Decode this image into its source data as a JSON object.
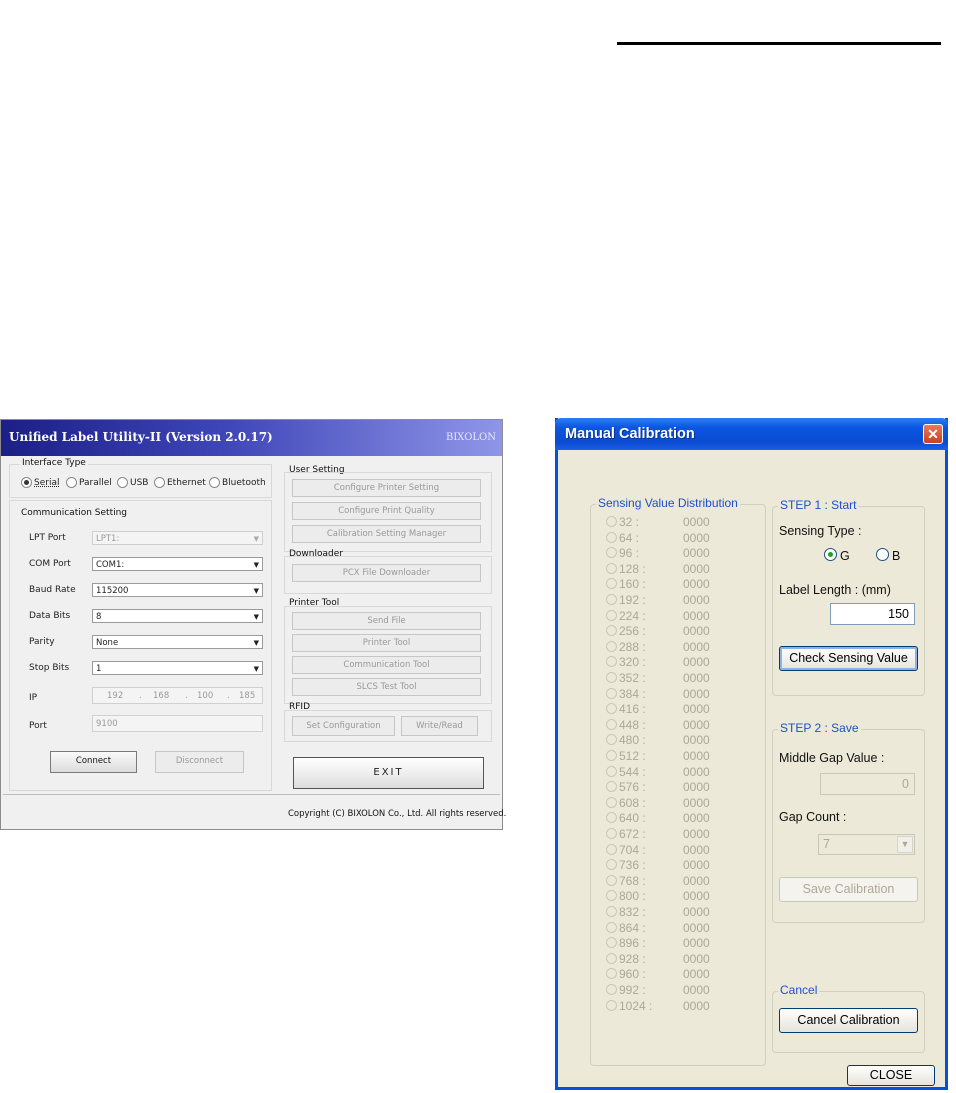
{
  "ulu": {
    "title": "Unified Label Utility-II (Version 2.0.17)",
    "brand": "BIXOLON",
    "interface_type": {
      "label": "Interface Type",
      "options": [
        "Serial",
        "Parallel",
        "USB",
        "Ethernet",
        "Bluetooth"
      ],
      "selected": "Serial"
    },
    "comm": {
      "label": "Communication Setting",
      "lpt_port": {
        "label": "LPT Port",
        "value": "LPT1:"
      },
      "com_port": {
        "label": "COM Port",
        "value": "COM1:"
      },
      "baud_rate": {
        "label": "Baud Rate",
        "value": "115200"
      },
      "data_bits": {
        "label": "Data Bits",
        "value": "8"
      },
      "parity": {
        "label": "Parity",
        "value": "None"
      },
      "stop_bits": {
        "label": "Stop Bits",
        "value": "1"
      },
      "ip": {
        "label": "IP",
        "octets": [
          "192",
          "168",
          "100",
          "185"
        ]
      },
      "port": {
        "label": "Port",
        "value": "9100"
      },
      "connect": "Connect",
      "disconnect": "Disconnect"
    },
    "user_setting": {
      "label": "User Setting",
      "buttons": [
        "Configure Printer Setting",
        "Configure Print Quality",
        "Calibration Setting Manager"
      ]
    },
    "downloader": {
      "label": "Downloader",
      "button": "PCX File Downloader"
    },
    "printer_tool": {
      "label": "Printer Tool",
      "buttons": [
        "Send File",
        "Printer Tool",
        "Communication Tool",
        "SLCS Test Tool"
      ]
    },
    "rfid": {
      "label": "RFID",
      "set_configuration": "Set Configuration",
      "write_read": "Write/Read"
    },
    "exit": "EXIT",
    "copyright": "Copyright (C) BIXOLON Co., Ltd. All rights reserved."
  },
  "mc": {
    "title": "Manual Calibration",
    "close_glyph": "✕",
    "sensing": {
      "label": "Sensing Value Distribution",
      "rows": [
        {
          "key": "32 :",
          "value": "0000"
        },
        {
          "key": "64 :",
          "value": "0000"
        },
        {
          "key": "96 :",
          "value": "0000"
        },
        {
          "key": "128 :",
          "value": "0000"
        },
        {
          "key": "160 :",
          "value": "0000"
        },
        {
          "key": "192 :",
          "value": "0000"
        },
        {
          "key": "224 :",
          "value": "0000"
        },
        {
          "key": "256 :",
          "value": "0000"
        },
        {
          "key": "288 :",
          "value": "0000"
        },
        {
          "key": "320 :",
          "value": "0000"
        },
        {
          "key": "352 :",
          "value": "0000"
        },
        {
          "key": "384 :",
          "value": "0000"
        },
        {
          "key": "416 :",
          "value": "0000"
        },
        {
          "key": "448 :",
          "value": "0000"
        },
        {
          "key": "480 :",
          "value": "0000"
        },
        {
          "key": "512 :",
          "value": "0000"
        },
        {
          "key": "544 :",
          "value": "0000"
        },
        {
          "key": "576 :",
          "value": "0000"
        },
        {
          "key": "608 :",
          "value": "0000"
        },
        {
          "key": "640 :",
          "value": "0000"
        },
        {
          "key": "672 :",
          "value": "0000"
        },
        {
          "key": "704 :",
          "value": "0000"
        },
        {
          "key": "736 :",
          "value": "0000"
        },
        {
          "key": "768 :",
          "value": "0000"
        },
        {
          "key": "800 :",
          "value": "0000"
        },
        {
          "key": "832 :",
          "value": "0000"
        },
        {
          "key": "864 :",
          "value": "0000"
        },
        {
          "key": "896 :",
          "value": "0000"
        },
        {
          "key": "928 :",
          "value": "0000"
        },
        {
          "key": "960 :",
          "value": "0000"
        },
        {
          "key": "992 :",
          "value": "0000"
        },
        {
          "key": "1024 :",
          "value": "0000"
        }
      ]
    },
    "step1": {
      "label": "STEP 1 : Start",
      "sensing_type_label": "Sensing Type :",
      "option_g": "G",
      "option_b": "B",
      "selected": "G",
      "label_length_label": "Label Length : (mm)",
      "label_length_value": "150",
      "check_button": "Check Sensing Value"
    },
    "step2": {
      "label": "STEP 2 : Save",
      "middle_gap_label": "Middle Gap Value :",
      "middle_gap_value": "0",
      "gap_count_label": "Gap Count :",
      "gap_count_value": "7",
      "save_button": "Save Calibration"
    },
    "cancel": {
      "label": "Cancel",
      "button": "Cancel Calibration"
    },
    "close_button": "CLOSE",
    "colors": {
      "title_bar": "#0a4bd2",
      "dialog_bg": "#ece9d8",
      "accent_text": "#1c51c8"
    }
  }
}
